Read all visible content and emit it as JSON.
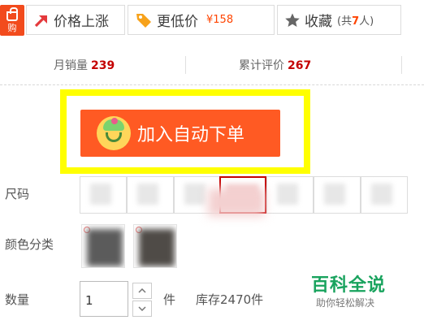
{
  "topbar": {
    "shop_icon_label": "购",
    "price_rise_label": "价格上涨",
    "lower_price_label": "更低价",
    "lower_price_value": "¥158",
    "favorite_label": "收藏",
    "favorite_count_prefix": "(共",
    "favorite_count": "7",
    "favorite_count_suffix": "人)"
  },
  "stats": {
    "monthly_sales_label": "月销量",
    "monthly_sales_value": "239",
    "reviews_label": "累计评价",
    "reviews_value": "267"
  },
  "auto_order": {
    "label": "加入自动下单"
  },
  "attributes": {
    "size_label": "尺码",
    "size_selected_index": 3,
    "color_label": "颜色分类",
    "quantity_label": "数量",
    "quantity_value": "1",
    "unit": "件",
    "stock": "库存2470件"
  },
  "watermark": {
    "title": "百科全说",
    "subtitle": "助你轻松解决"
  },
  "colors": {
    "accent": "#ff5a23",
    "price_red": "#c40000",
    "highlight": "#ffff00",
    "watermark_green": "#19a35e"
  }
}
